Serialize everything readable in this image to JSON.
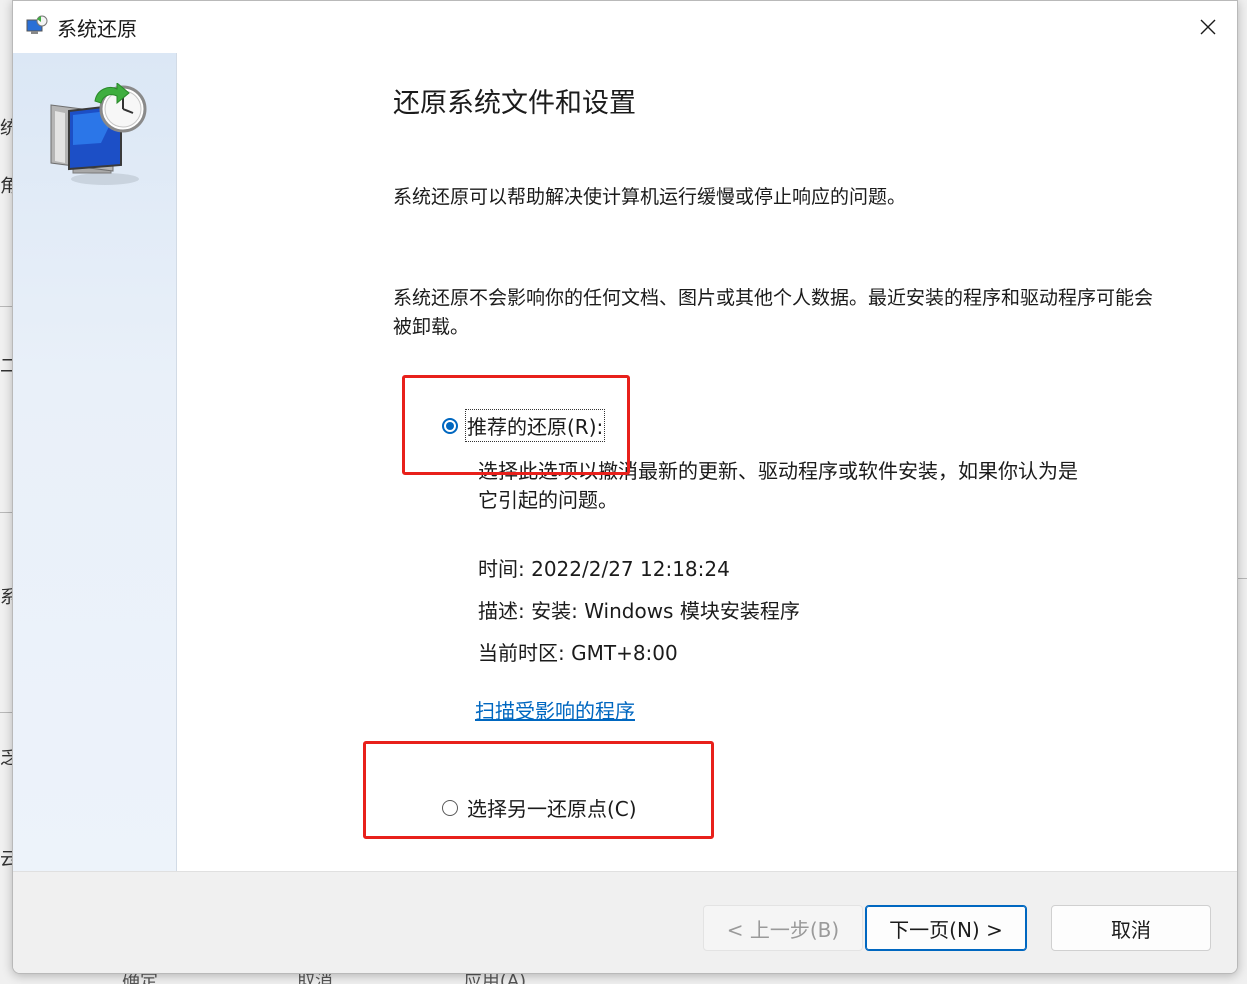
{
  "window": {
    "title": "系统还原"
  },
  "content": {
    "heading": "还原系统文件和设置",
    "para1": "系统还原可以帮助解决使计算机运行缓慢或停止响应的问题。",
    "para2": "系统还原不会影响你的任何文档、图片或其他个人数据。最近安装的程序和驱动程序可能会被卸载。"
  },
  "options": {
    "recommended": {
      "label": "推荐的还原(R):",
      "selected": true,
      "description": "选择此选项以撤消最新的更新、驱动程序或软件安装，如果你认为是它引起的问题。",
      "time": "时间: 2022/2/27 12:18:24",
      "desc": "描述: 安装: Windows 模块安装程序",
      "timezone": "当前时区: GMT+8:00",
      "scan_link": "扫描受影响的程序"
    },
    "other": {
      "label": "选择另一还原点(C)",
      "selected": false
    }
  },
  "footer": {
    "back": "< 上一步(B)",
    "next": "下一页(N) >",
    "cancel": "取消"
  },
  "background_window": {
    "edge_texts": [
      "统",
      "角",
      "二",
      "系",
      "乏",
      "云"
    ],
    "buttons": [
      "确定",
      "取消",
      "应用(A)"
    ]
  },
  "colors": {
    "accent": "#0067c0",
    "annotation": "#e8201b",
    "side_panel": "#dbe7f5"
  },
  "icons": {
    "title": "system-restore-icon",
    "side": "system-restore-monitor-clock-icon",
    "close": "close-icon"
  }
}
